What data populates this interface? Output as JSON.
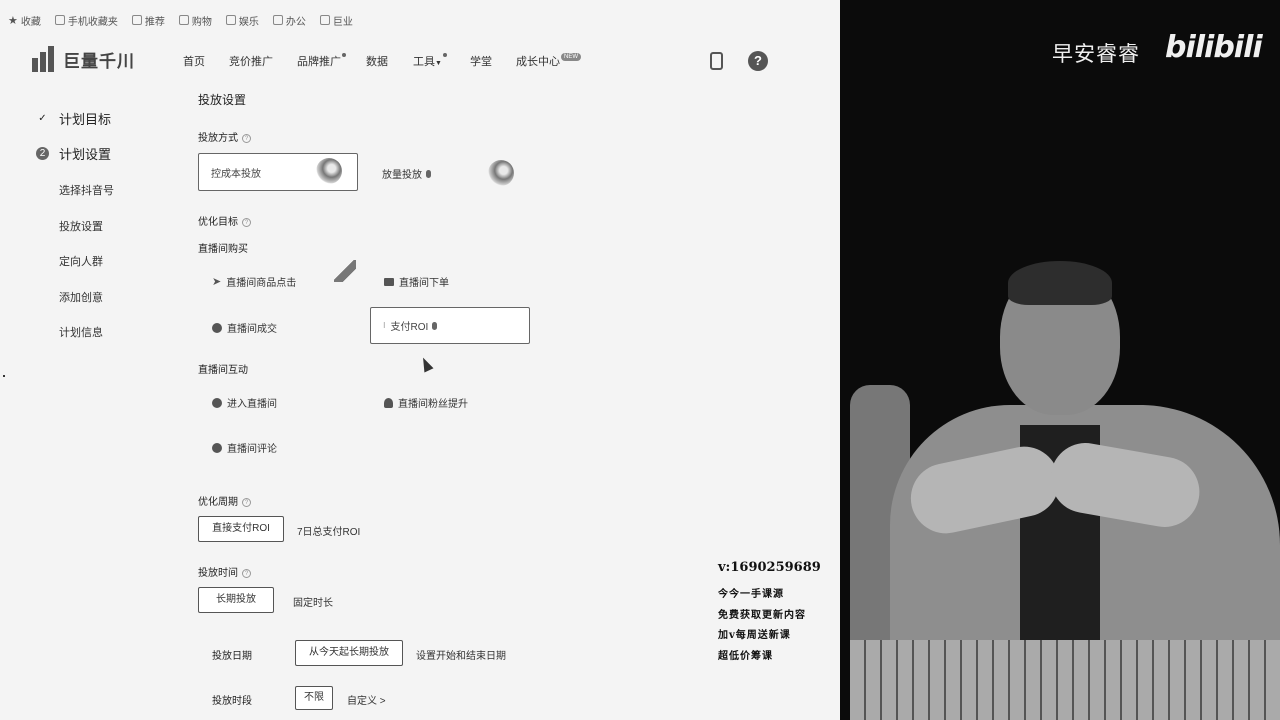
{
  "bookmarks": [
    "收藏",
    "手机收藏夹",
    "推荐",
    "购物",
    "娱乐",
    "办公",
    "巨业"
  ],
  "brand": {
    "name": "巨量千川"
  },
  "nav": {
    "items": [
      "首页",
      "竞价推广",
      "品牌推广",
      "数据",
      "工具",
      "学堂",
      "成长中心"
    ],
    "badge": "NEW"
  },
  "sidebar": {
    "step1": "计划目标",
    "step2": "计划设置",
    "step2_number": "2",
    "subitems": [
      "选择抖音号",
      "投放设置",
      "定向人群",
      "添加创意",
      "计划信息"
    ]
  },
  "form": {
    "section_title": "投放设置",
    "method": {
      "label": "投放方式",
      "options": [
        "控成本投放",
        "放量投放"
      ]
    },
    "goal": {
      "label": "优化目标",
      "group1": "直播间购买",
      "group1_options": [
        "直播间商品点击",
        "直播间下单",
        "直播间成交",
        "支付ROI"
      ],
      "group2": "直播间互动",
      "group2_options": [
        "进入直播间",
        "直播间粉丝提升",
        "直播间评论"
      ]
    },
    "cycle": {
      "label": "优化周期",
      "options": [
        "直接支付ROI",
        "7日总支付ROI"
      ]
    },
    "time": {
      "label": "投放时间",
      "options": [
        "长期投放",
        "固定时长"
      ]
    },
    "date": {
      "label": "投放日期",
      "options": [
        "从今天起长期投放",
        "设置开始和结束日期"
      ]
    },
    "period": {
      "label": "投放时段",
      "options": [
        "不限",
        "自定义 >"
      ]
    }
  },
  "video": {
    "channel": "早安睿睿",
    "platform_logo": "bilibili",
    "contact": "v:1690259689",
    "promo_lines": [
      "今今一手课源",
      "免费获取更新内容",
      "加v每周送新课",
      "超低价筹课"
    ]
  }
}
